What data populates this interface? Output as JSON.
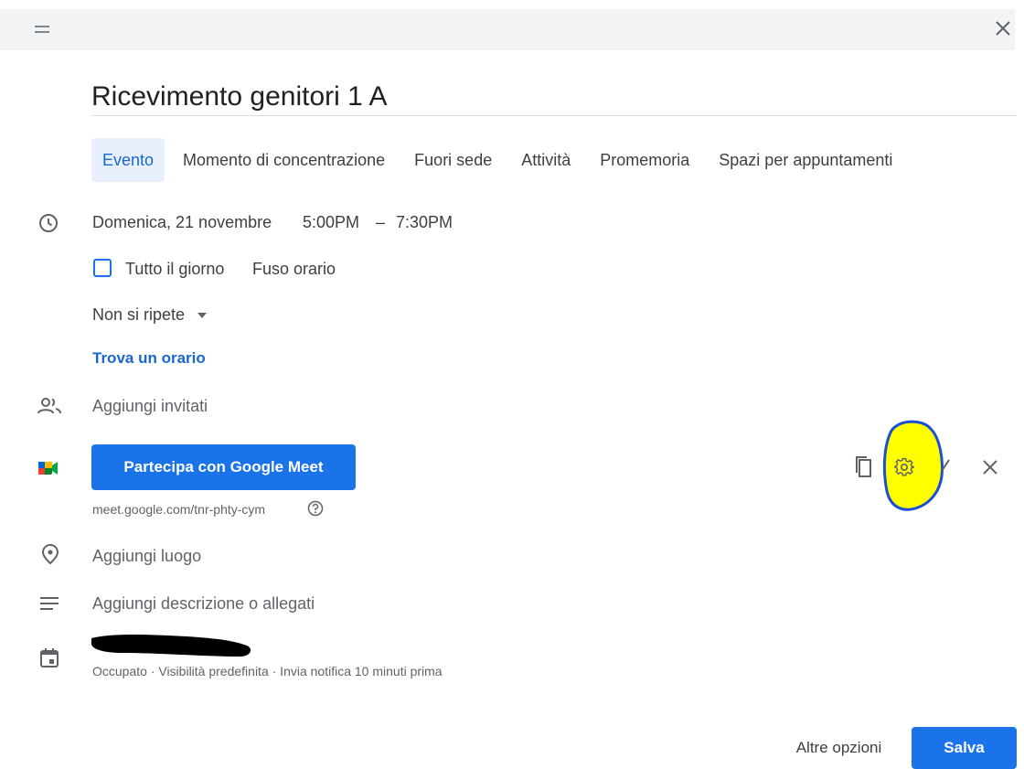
{
  "header": {
    "title": "Ricevimento genitori 1 A"
  },
  "tabs": [
    {
      "label": "Evento",
      "active": true
    },
    {
      "label": "Momento di concentrazione"
    },
    {
      "label": "Fuori sede"
    },
    {
      "label": "Attività"
    },
    {
      "label": "Promemoria"
    },
    {
      "label": "Spazi per appuntamenti"
    }
  ],
  "datetime": {
    "date": "Domenica, 21 novembre",
    "start": "5:00PM",
    "dash": "–",
    "end": "7:30PM"
  },
  "allday": {
    "checkbox_label": "Tutto il giorno",
    "timezone_label": "Fuso orario",
    "checked": false
  },
  "recurrence": {
    "value": "Non si ripete"
  },
  "find_time": {
    "label": "Trova un orario"
  },
  "guests": {
    "placeholder": "Aggiungi invitati"
  },
  "meet": {
    "button_label": "Partecipa con Google Meet",
    "link": "meet.google.com/tnr-phty-cym"
  },
  "location": {
    "placeholder": "Aggiungi luogo"
  },
  "description": {
    "placeholder": "Aggiungi descrizione o allegati"
  },
  "calendar": {
    "details": "Occupato · Visibilità predefinita · Invia notifica 10 minuti prima"
  },
  "footer": {
    "more_options": "Altre opzioni",
    "save": "Salva"
  },
  "colors": {
    "accent": "#1a73e8",
    "active_tab_bg": "#e8f0fe",
    "highlight": "#ffff00",
    "annotation": "#1a4fd6"
  }
}
